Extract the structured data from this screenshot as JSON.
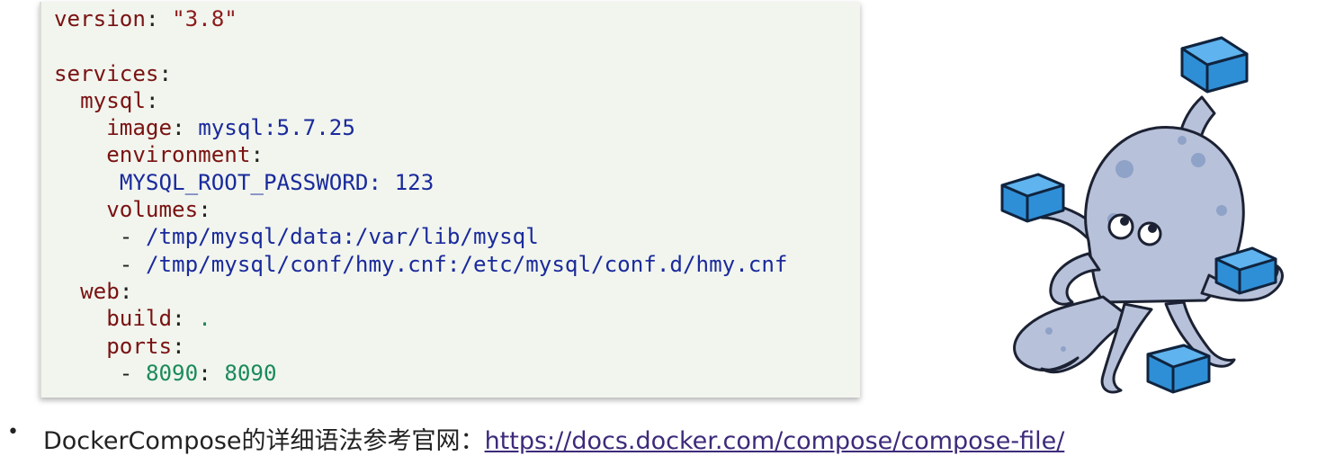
{
  "code": {
    "lines": [
      [
        {
          "c": "k",
          "t": "version"
        },
        {
          "c": "p",
          "t": ": "
        },
        {
          "c": "s",
          "t": "\"3.8\""
        }
      ],
      [],
      [
        {
          "c": "k",
          "t": "services"
        },
        {
          "c": "p",
          "t": ":"
        }
      ],
      [
        {
          "c": "p",
          "t": "  "
        },
        {
          "c": "k",
          "t": "mysql"
        },
        {
          "c": "p",
          "t": ":"
        }
      ],
      [
        {
          "c": "p",
          "t": "    "
        },
        {
          "c": "k",
          "t": "image"
        },
        {
          "c": "p",
          "t": ": "
        },
        {
          "c": "v",
          "t": "mysql:5.7.25"
        }
      ],
      [
        {
          "c": "p",
          "t": "    "
        },
        {
          "c": "k",
          "t": "environment"
        },
        {
          "c": "p",
          "t": ":"
        }
      ],
      [
        {
          "c": "p",
          "t": "     "
        },
        {
          "c": "v",
          "t": "MYSQL_ROOT_PASSWORD: 123"
        }
      ],
      [
        {
          "c": "p",
          "t": "    "
        },
        {
          "c": "k",
          "t": "volumes"
        },
        {
          "c": "p",
          "t": ":"
        }
      ],
      [
        {
          "c": "p",
          "t": "     - "
        },
        {
          "c": "v",
          "t": "/tmp/mysql/data:/var/lib/mysql"
        }
      ],
      [
        {
          "c": "p",
          "t": "     - "
        },
        {
          "c": "v",
          "t": "/tmp/mysql/conf/hmy.cnf:/etc/mysql/conf.d/hmy.cnf"
        }
      ],
      [
        {
          "c": "p",
          "t": "  "
        },
        {
          "c": "k",
          "t": "web"
        },
        {
          "c": "p",
          "t": ":"
        }
      ],
      [
        {
          "c": "p",
          "t": "    "
        },
        {
          "c": "k",
          "t": "build"
        },
        {
          "c": "p",
          "t": ": "
        },
        {
          "c": "n",
          "t": "."
        }
      ],
      [
        {
          "c": "p",
          "t": "    "
        },
        {
          "c": "k",
          "t": "ports"
        },
        {
          "c": "p",
          "t": ":"
        }
      ],
      [
        {
          "c": "p",
          "t": "     - "
        },
        {
          "c": "n",
          "t": "8090"
        },
        {
          "c": "p",
          "t": ": "
        },
        {
          "c": "n",
          "t": "8090"
        }
      ]
    ]
  },
  "logo": {
    "icon": "docker-compose-octopus-icon"
  },
  "bullet": {
    "dot": "•",
    "text": "DockerCompose的详细语法参考官网：",
    "link_text": "https://docs.docker.com/compose/compose-file/"
  },
  "colors": {
    "code_background": "#f1f5ee",
    "key": "#7a1212",
    "string": "#8c1b1b",
    "value": "#1a2a9c",
    "number": "#1b8a5a",
    "link": "#3d2a7a",
    "octopus_body": "#b7c1d9",
    "octopus_spots": "#8fa2c8",
    "box_blue": "#2f8fd6"
  }
}
